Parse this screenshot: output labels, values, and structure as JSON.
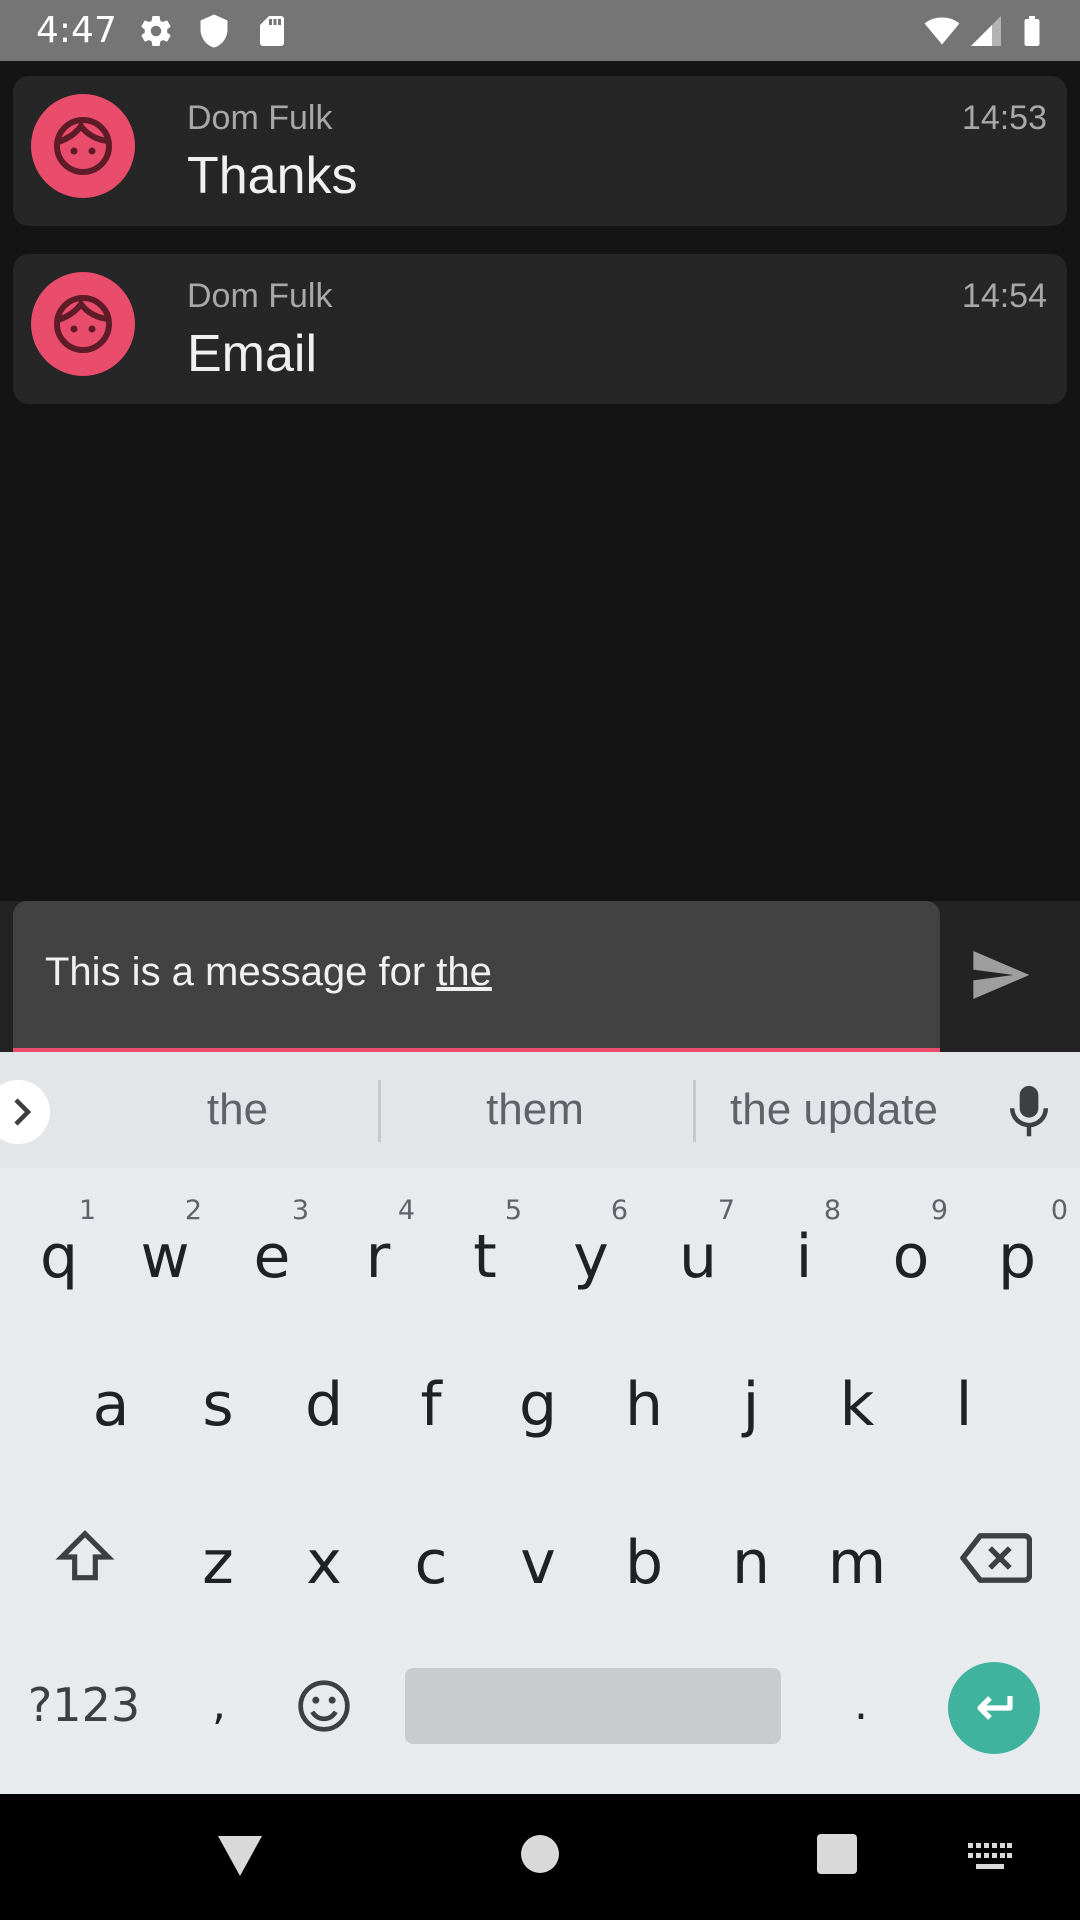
{
  "status_bar": {
    "time": "4:47",
    "icons": [
      "settings-icon",
      "shield-icon",
      "sd-card-icon",
      "wifi-icon",
      "cell-signal-icon",
      "battery-icon"
    ]
  },
  "messages": [
    {
      "sender": "Dom Fulk",
      "time": "14:53",
      "text": "Thanks"
    },
    {
      "sender": "Dom Fulk",
      "time": "14:54",
      "text": "Email"
    }
  ],
  "composer": {
    "text_before": "This is a message for ",
    "composing_word": "the",
    "send_icon": "send-icon"
  },
  "keyboard": {
    "suggestions": [
      "the",
      "them",
      "the update"
    ],
    "row1": [
      {
        "key": "q",
        "hint": "1"
      },
      {
        "key": "w",
        "hint": "2"
      },
      {
        "key": "e",
        "hint": "3"
      },
      {
        "key": "r",
        "hint": "4"
      },
      {
        "key": "t",
        "hint": "5"
      },
      {
        "key": "y",
        "hint": "6"
      },
      {
        "key": "u",
        "hint": "7"
      },
      {
        "key": "i",
        "hint": "8"
      },
      {
        "key": "o",
        "hint": "9"
      },
      {
        "key": "p",
        "hint": "0"
      }
    ],
    "row2": [
      "a",
      "s",
      "d",
      "f",
      "g",
      "h",
      "j",
      "k",
      "l"
    ],
    "row3": [
      "z",
      "x",
      "c",
      "v",
      "b",
      "n",
      "m"
    ],
    "symbols_label": "?123",
    "comma": ",",
    "period": "."
  },
  "colors": {
    "accent": "#ea4d6b",
    "enter_key": "#40b39f",
    "background": "#141414",
    "card": "#262626"
  }
}
